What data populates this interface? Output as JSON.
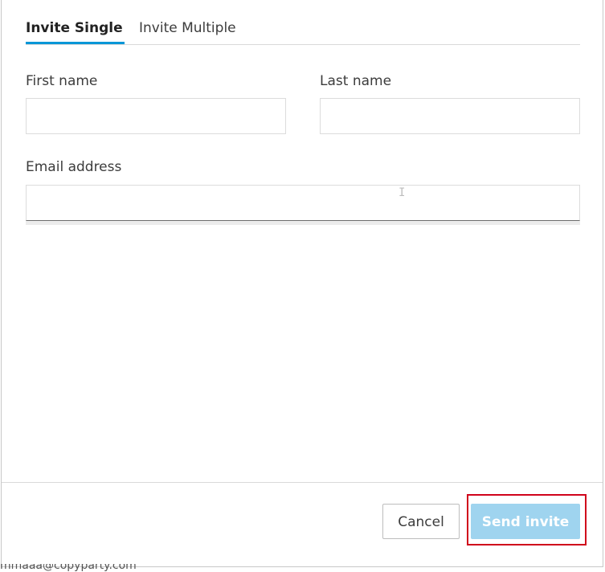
{
  "tabs": [
    {
      "label": "Invite Single",
      "active": true
    },
    {
      "label": "Invite Multiple",
      "active": false
    }
  ],
  "form": {
    "first_name": {
      "label": "First name",
      "value": ""
    },
    "last_name": {
      "label": "Last name",
      "value": ""
    },
    "email": {
      "label": "Email address",
      "value": ""
    }
  },
  "footer": {
    "cancel_label": "Cancel",
    "send_label": "Send invite"
  },
  "background_text": "mmaaa@copyparty.com",
  "colors": {
    "accent": "#0696d7",
    "send_button_disabled": "#9fd4ef",
    "highlight": "#d0021b"
  }
}
